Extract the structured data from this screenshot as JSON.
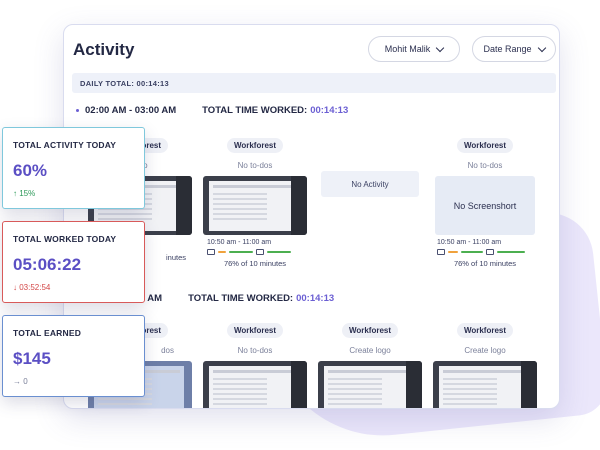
{
  "header": {
    "title": "Activity",
    "user_filter": "Mohit Malik",
    "date_filter": "Date Range"
  },
  "daily_total": "DAILY TOTAL: 00:14:13",
  "slots": [
    {
      "range": "02:00 AM - 03:00 AM",
      "total_label": "TOTAL TIME WORKED:",
      "total_value": "00:14:13"
    },
    {
      "range": "3:00 AM",
      "total_label": "TOTAL TIME WORKED:",
      "total_value": "00:14:13"
    }
  ],
  "row1": [
    {
      "project": "Workforest",
      "todo": "logo",
      "time": "",
      "pct": "inutes",
      "screenshot": true
    },
    {
      "project": "Workforest",
      "todo": "No to-dos",
      "time": "10:50 am - 11:00 am",
      "pct": "76% of 10 minutes",
      "screenshot": true
    },
    {
      "no_activity": "No Activity"
    },
    {
      "project": "Workforest",
      "todo": "No to-dos",
      "time": "10:50 am - 11:00 am",
      "pct": "76% of 10 minutes",
      "no_screenshot": "No Screenshort"
    }
  ],
  "row2": [
    {
      "project": "Workforest",
      "todo": "dos"
    },
    {
      "project": "Workforest",
      "todo": "No to-dos"
    },
    {
      "project": "Workforest",
      "todo": "Create logo"
    },
    {
      "project": "Workforest",
      "todo": "Create logo"
    }
  ],
  "stats": {
    "activity": {
      "label": "TOTAL ACTIVITY TODAY",
      "value": "60%",
      "delta": "↑ 15%",
      "border": "#7fc8dc"
    },
    "worked": {
      "label": "TOTAL WORKED TODAY",
      "value": "05:06:22",
      "delta": "↓ 03:52:54",
      "border": "#d85a5a"
    },
    "earned": {
      "label": "TOTAL EARNED",
      "value": "$145",
      "delta": "→ 0",
      "border": "#6a8fd0"
    }
  },
  "colors": {
    "accent": "#5b4fc4",
    "progress_green": "#4caf50",
    "progress_orange": "#f0a23c"
  }
}
